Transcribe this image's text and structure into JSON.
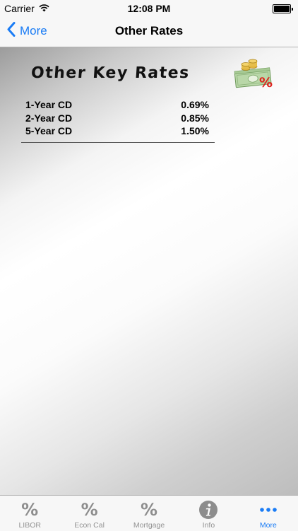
{
  "status_bar": {
    "carrier": "Carrier",
    "time": "12:08 PM",
    "battery_level": 1.0
  },
  "nav": {
    "back_label": "More",
    "title": "Other Rates"
  },
  "panel": {
    "title": "Other Key Rates",
    "icon": "money-percent-icon",
    "rates": [
      {
        "label": "1-Year CD",
        "value": "0.69%"
      },
      {
        "label": "2-Year CD",
        "value": "0.85%"
      },
      {
        "label": "5-Year CD",
        "value": "1.50%"
      }
    ]
  },
  "tab_bar": {
    "items": [
      {
        "label": "LIBOR",
        "icon": "percent-icon"
      },
      {
        "label": "Econ Cal",
        "icon": "percent-icon"
      },
      {
        "label": "Mortgage",
        "icon": "percent-icon"
      },
      {
        "label": "Info",
        "icon": "info-icon"
      },
      {
        "label": "More",
        "icon": "more-dots-icon"
      }
    ],
    "active_index": 4
  },
  "colors": {
    "accent": "#1a7cf5",
    "inactive": "#929292",
    "bar_background": "#f7f7f7"
  }
}
